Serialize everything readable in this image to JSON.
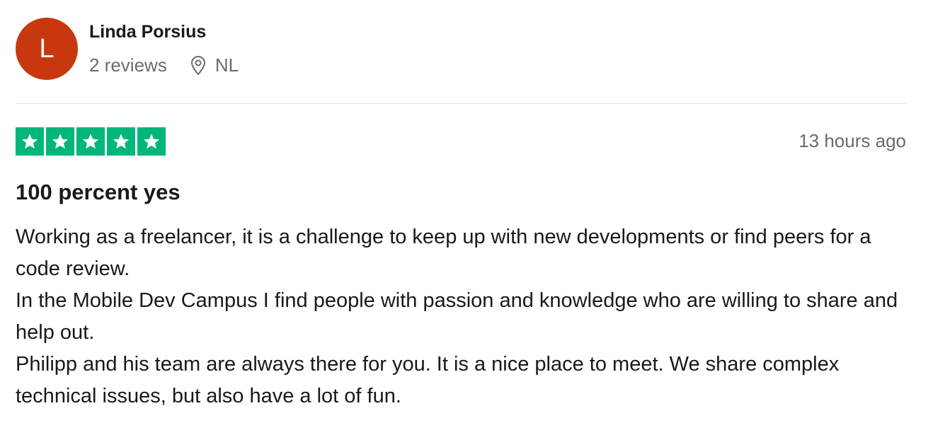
{
  "reviewer": {
    "avatar_initial": "L",
    "avatar_color": "#c8380f",
    "name": "Linda Porsius",
    "reviews_count": "2 reviews",
    "location_icon": "location-pin-icon",
    "country": "NL"
  },
  "review": {
    "rating": 5,
    "max_rating": 5,
    "star_color": "#00b67a",
    "star_icon": "star-icon",
    "time_ago": "13 hours ago",
    "title": "100 percent yes",
    "paragraphs": [
      "Working as a freelancer, it is a challenge to keep up with new developments or find peers for a code review.",
      "In the Mobile Dev Campus I find people with passion and knowledge who are willing to share and help out.",
      "Philipp and his team are always there for you. It is a nice place to meet. We share complex technical issues, but also have a lot of fun."
    ]
  }
}
